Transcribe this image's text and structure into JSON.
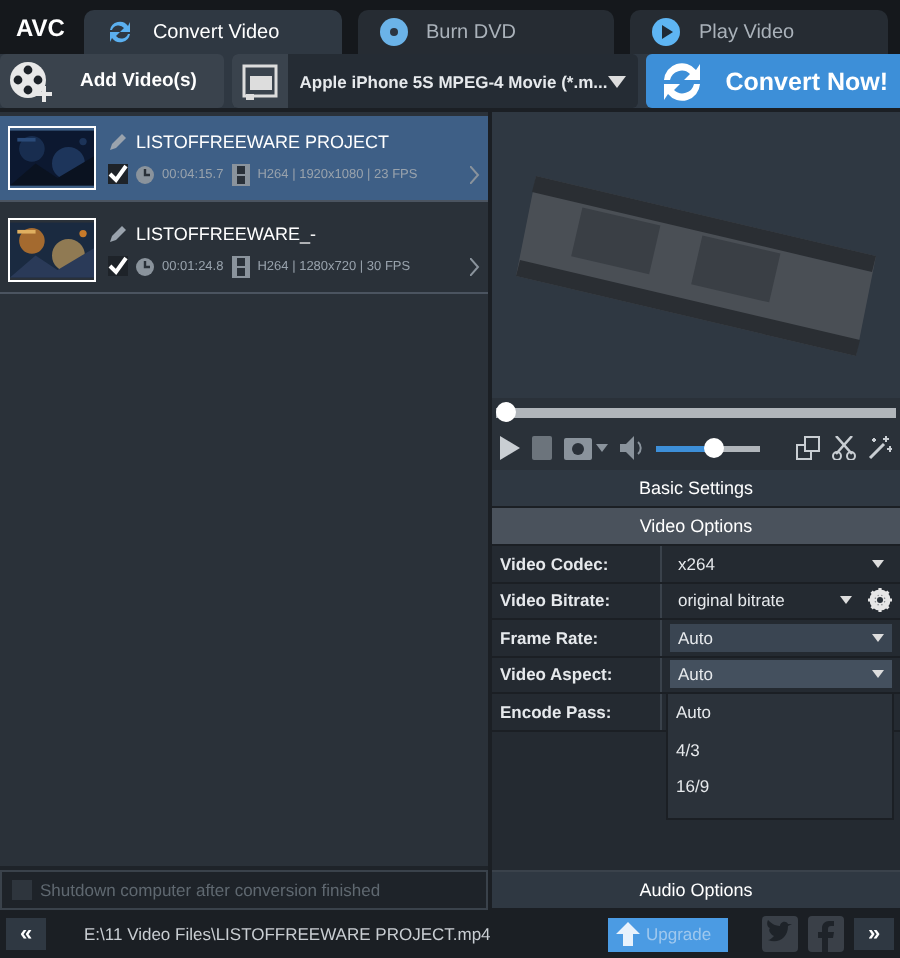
{
  "logo": "AVC",
  "tabs": [
    {
      "label": "Convert Video",
      "selected": true
    },
    {
      "label": "Burn DVD",
      "selected": false
    },
    {
      "label": "Play Video",
      "selected": false
    }
  ],
  "toolbar": {
    "add_button": "Add Video(s)",
    "profile": "Apple iPhone 5S MPEG-4 Movie (*.m...",
    "convert_button": "Convert Now!"
  },
  "files": [
    {
      "name": "LISTOFFREEWARE PROJECT",
      "selected": true,
      "checked": true,
      "duration": "00:04:15.7",
      "info": "H264 | 1920x1080 | 23 FPS"
    },
    {
      "name": "LISTOFFREEWARE_-",
      "selected": false,
      "checked": true,
      "duration": "00:01:24.8",
      "info": "H264 | 1280x720 | 30 FPS"
    }
  ],
  "shutdown": {
    "label": "Shutdown computer after conversion finished",
    "checked": false
  },
  "player": {
    "seek": {
      "level": 0
    },
    "volume": {
      "level": 0.55
    }
  },
  "settings": {
    "basic": "Basic Settings",
    "video": "Video Options",
    "rows": [
      {
        "label": "Video Codec:",
        "value": "x264",
        "kind": "select",
        "active": false
      },
      {
        "label": "Video Bitrate:",
        "value": "original bitrate",
        "kind": "select-settings",
        "active": false
      },
      {
        "label": "Frame Rate:",
        "value": "Auto",
        "kind": "select",
        "active": true
      },
      {
        "label": "Video Aspect:",
        "value": "Auto",
        "kind": "select",
        "active": true,
        "expanded": true
      },
      {
        "label": "Encode Pass:",
        "kind": "hidden"
      }
    ],
    "options": [
      {
        "label": "Auto",
        "selected": false
      },
      {
        "label": "4/3",
        "selected": false
      },
      {
        "label": "16/9",
        "selected": false
      }
    ],
    "audio": "Audio Options"
  },
  "status": {
    "prev": "«",
    "path": "E:\\11 Video Files\\LISTOFFREEWARE PROJECT.mp4",
    "upgrade": "Upgrade",
    "next": "»"
  }
}
